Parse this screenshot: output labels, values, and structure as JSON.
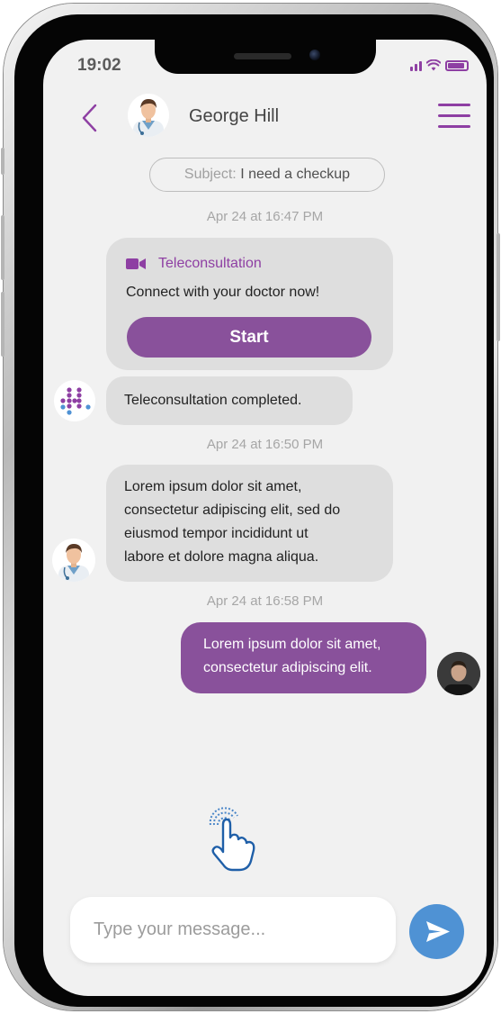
{
  "status_bar": {
    "time": "19:02"
  },
  "header": {
    "contact_name": "George Hill"
  },
  "subject": {
    "label": "Subject:",
    "value": "I need a checkup"
  },
  "messages": {
    "timestamp_1": "Apr 24 at 16:47 PM",
    "teleconsultation": {
      "title": "Teleconsultation",
      "text": "Connect with your doctor now!",
      "button_label": "Start"
    },
    "completed_text": "Teleconsultation completed.",
    "timestamp_2": "Apr 24 at 16:50 PM",
    "doctor_lines": [
      "Lorem ipsum dolor sit amet,",
      "consectetur adipiscing elit, sed do",
      "eiusmod tempor incididunt ut",
      "labore et dolore magna aliqua."
    ],
    "timestamp_3": "Apr 24 at 16:58 PM",
    "user_lines": [
      "Lorem ipsum dolor sit amet,",
      "consectetur adipiscing elit."
    ]
  },
  "composer": {
    "placeholder": "Type your message..."
  },
  "colors": {
    "accent_purple": "#89519b",
    "send_blue": "#4f92d4",
    "bubble_gray": "#dedede",
    "screen_bg": "#f1f1f1"
  },
  "icons": [
    "back-arrow-icon",
    "hamburger-menu-icon",
    "video-camera-icon",
    "send-icon",
    "tap-hand-icon",
    "signal-icon",
    "wifi-icon",
    "battery-icon"
  ]
}
